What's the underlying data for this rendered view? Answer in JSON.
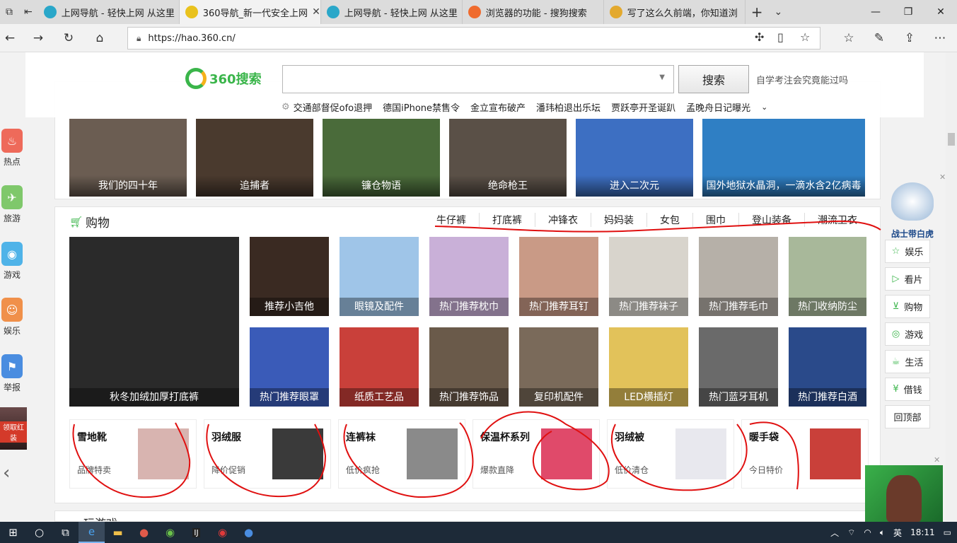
{
  "browser": {
    "tabs": [
      {
        "title": "上网导航 - 轻快上网 从这里",
        "color": "#2aa7c9",
        "active": false
      },
      {
        "title": "360导航_新一代安全上网",
        "color": "#e9c21d",
        "active": true
      },
      {
        "title": "上网导航 - 轻快上网 从这里",
        "color": "#2aa7c9",
        "active": false
      },
      {
        "title": "浏览器的功能 - 搜狗搜索",
        "color": "#ef6b2e",
        "active": false
      },
      {
        "title": "写了这么久前端，你知道浏",
        "color": "#e3a92e",
        "active": false
      }
    ],
    "new_tab": "+",
    "tab_list": "⌄",
    "url": "https://hao.360.cn/"
  },
  "left_rail": [
    {
      "label": "热点",
      "color": "#ee6a5a"
    },
    {
      "label": "旅游",
      "color": "#7fc86b"
    },
    {
      "label": "游戏",
      "color": "#4fb3e8"
    },
    {
      "label": "娱乐",
      "color": "#f0904a"
    },
    {
      "label": "举报",
      "color": "#4a8de0"
    }
  ],
  "left_ad": "领取红装",
  "search": {
    "logo_text": "360搜索",
    "button": "搜索",
    "hint": "自学考注会究竟能过吗",
    "hot_words": [
      "交通部督促ofo退押",
      "德国iPhone禁售令",
      "金立宣布破产",
      "潘玮柏退出乐坛",
      "贾跃亭开圣诞趴",
      "孟晚舟日记曝光"
    ]
  },
  "hot_movies": [
    {
      "title": "我们的四十年",
      "color": "#6b5d52"
    },
    {
      "title": "追捕者",
      "color": "#4a3a2e"
    },
    {
      "title": "镰仓物语",
      "color": "#4a6b3a"
    },
    {
      "title": "绝命枪王",
      "color": "#5a5047"
    },
    {
      "title": "进入二次元",
      "color": "#3d6fc2"
    },
    {
      "title": "国外地狱水晶洞，一滴水含2亿病毒",
      "color": "#2f7fc4"
    }
  ],
  "shopping": {
    "title": "购物",
    "tabs": [
      "牛仔裤",
      "打底裤",
      "冲锋衣",
      "妈妈装",
      "女包",
      "围巾",
      "登山装备",
      "潮流卫衣"
    ],
    "big_item": {
      "title": "秋冬加绒加厚打底裤",
      "color": "#2a2a2a"
    },
    "row1": [
      {
        "title": "推荐小吉他",
        "color": "#3a2a22"
      },
      {
        "title": "眼镜及配件",
        "color": "#9fc5e8"
      },
      {
        "title": "热门推荐枕巾",
        "color": "#c9b0d8"
      },
      {
        "title": "热门推荐耳钉",
        "color": "#c99a86"
      },
      {
        "title": "热门推荐袜子",
        "color": "#d8d4cc"
      },
      {
        "title": "热门推荐毛巾",
        "color": "#b6b0a8"
      },
      {
        "title": "热门收纳防尘",
        "color": "#a8b89a"
      }
    ],
    "row2": [
      {
        "title": "热门推荐眼罩",
        "color": "#3a5bb8"
      },
      {
        "title": "纸质工艺品",
        "color": "#c9403a"
      },
      {
        "title": "热门推荐饰品",
        "color": "#6a5a4a"
      },
      {
        "title": "复印机配件",
        "color": "#7a6a5a"
      },
      {
        "title": "LED横插灯",
        "color": "#e2c25a"
      },
      {
        "title": "热门蓝牙耳机",
        "color": "#6a6a6a"
      },
      {
        "title": "热门推荐白酒",
        "color": "#2a4a8a"
      }
    ],
    "promos": [
      {
        "title": "雪地靴",
        "sub": "品牌特卖",
        "color": "#d8b4b0"
      },
      {
        "title": "羽绒服",
        "sub": "降价促销",
        "color": "#3a3a3a"
      },
      {
        "title": "连裤袜",
        "sub": "低价疯抢",
        "color": "#8a8a8a"
      },
      {
        "title": "保温杯系列",
        "sub": "爆款直降",
        "color": "#e04a6a"
      },
      {
        "title": "羽绒被",
        "sub": "低价清仓",
        "color": "#e8e8ee"
      },
      {
        "title": "暖手袋",
        "sub": "今日特价",
        "color": "#c9403a"
      }
    ]
  },
  "right_rail": {
    "mascot": "战士带白虎",
    "items": [
      "娱乐",
      "看片",
      "购物",
      "游戏",
      "生活",
      "借钱"
    ],
    "back_top": "回顶部"
  },
  "next_section": {
    "title": "玩游戏"
  },
  "taskbar": {
    "lang": "英",
    "time": "18:11"
  }
}
